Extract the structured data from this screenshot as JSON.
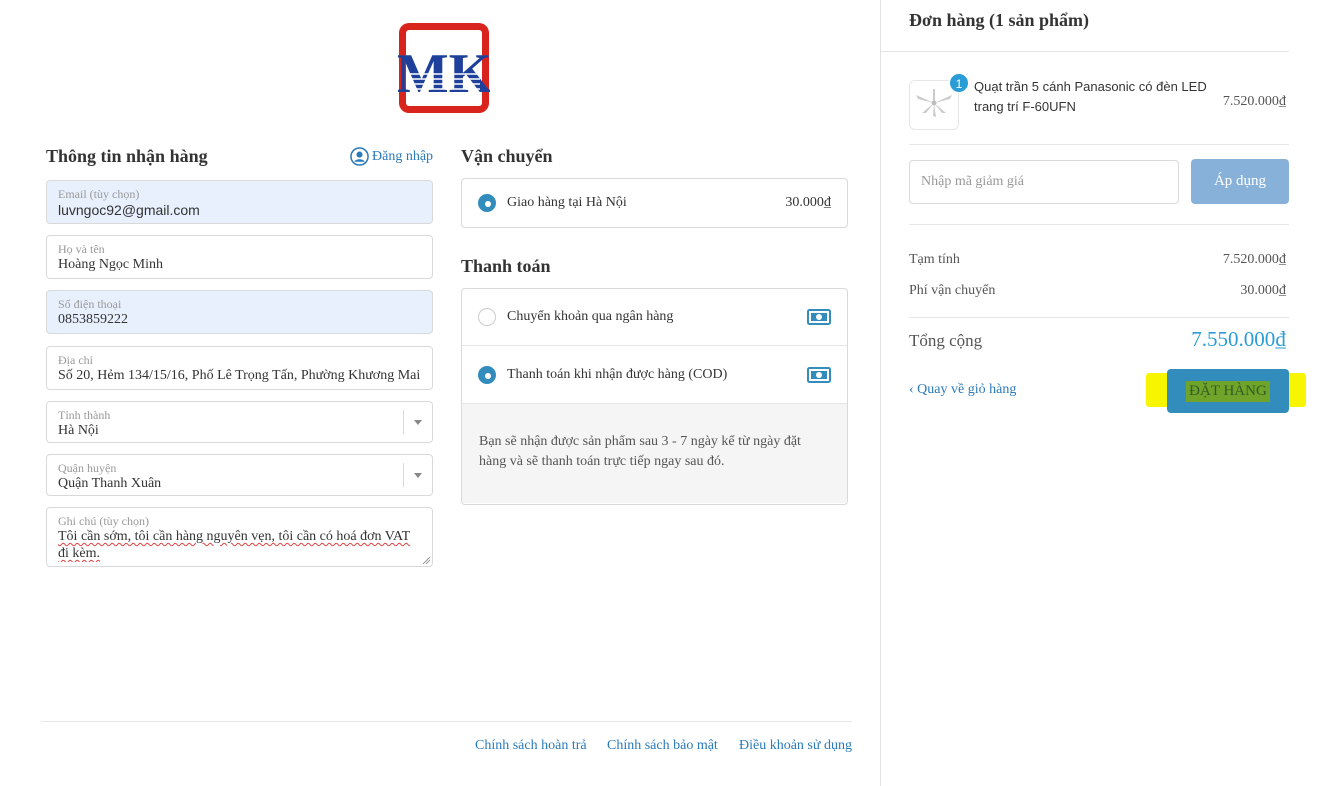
{
  "logo": {
    "text": "MK"
  },
  "shipping_info": {
    "title": "Thông tin nhận hàng",
    "login_label": "Đăng nhập",
    "email": {
      "label": "Email (tùy chọn)",
      "value": "luvngoc92@gmail.com"
    },
    "name": {
      "label": "Họ và tên",
      "value": "Hoàng Ngọc Minh"
    },
    "phone": {
      "label": "Số điện thoại",
      "value": "0853859222"
    },
    "address": {
      "label": "Địa chỉ",
      "value": "Số 20, Hẻm 134/15/16, Phố Lê Trọng Tấn, Phường Khương Mai"
    },
    "province": {
      "label": "Tỉnh thành",
      "value": "Hà Nội"
    },
    "district": {
      "label": "Quận huyện",
      "value": "Quận Thanh Xuân"
    },
    "note": {
      "label": "Ghi chú (tùy chọn)",
      "value": "Tôi cần sớm, tôi cần hàng nguyên vẹn, tôi cần có hoá đơn VAT đi kèm."
    }
  },
  "shipping": {
    "title": "Vận chuyển",
    "option_label": "Giao hàng tại Hà Nội",
    "option_price": "30.000₫"
  },
  "payment": {
    "title": "Thanh toán",
    "options": [
      {
        "label": "Chuyển khoản qua ngân hàng",
        "selected": false,
        "icon": "cash-icon"
      },
      {
        "label": "Thanh toán khi nhận được hàng (COD)",
        "selected": true,
        "icon": "cash-icon"
      }
    ],
    "note": "Bạn sẽ nhận được sản phẩm sau 3 - 7 ngày kể từ ngày đặt hàng và sẽ thanh toán trực tiếp ngay sau đó."
  },
  "footer_links": [
    "Chính sách hoàn trả",
    "Chính sách bảo mật",
    "Điều khoản sử dụng"
  ],
  "order": {
    "title": "Đơn hàng (1 sản phẩm)",
    "item": {
      "quantity": "1",
      "name": "Quạt trần 5 cánh Panasonic có đèn LED trang trí F-60UFN",
      "price": "7.520.000₫"
    },
    "coupon_placeholder": "Nhập mã giảm giá",
    "apply_label": "Áp dụng",
    "subtotal_label": "Tạm tính",
    "subtotal_value": "7.520.000₫",
    "shipping_fee_label": "Phí vận chuyển",
    "shipping_fee_value": "30.000₫",
    "total_label": "Tổng cộng",
    "total_value": "7.550.000₫",
    "back_label": "Quay về giỏ hàng",
    "place_order_label": "ĐẶT HÀNG"
  },
  "colors": {
    "accent": "#338dbc",
    "link": "#2a7ab9",
    "total": "#2a9dd7",
    "highlight": "#f7f500"
  }
}
